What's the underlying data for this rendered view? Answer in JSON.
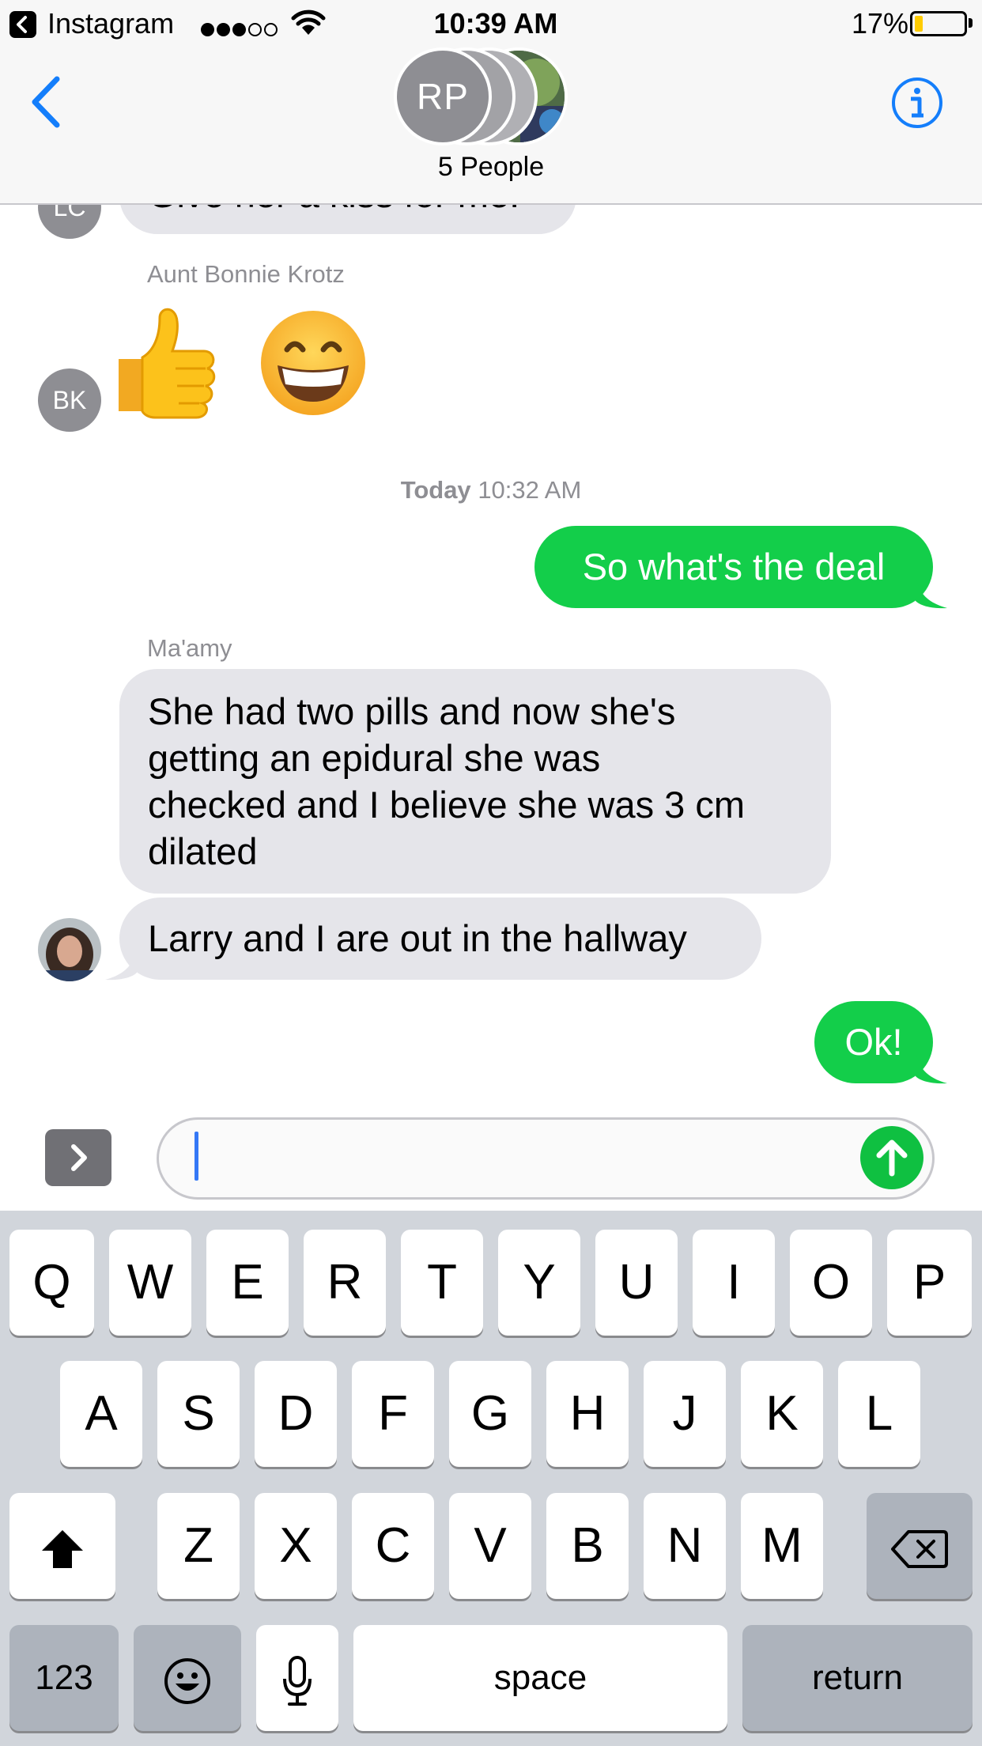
{
  "status_bar": {
    "back_app": "Instagram",
    "signal_bars_filled": 3,
    "signal_bars_total": 5,
    "time": "10:39 AM",
    "battery_percent": "17%",
    "battery_level": 0.17
  },
  "header": {
    "group_initials": "RP",
    "group_count": "5 People"
  },
  "conversation": {
    "partial_message": {
      "avatar_initials": "LC",
      "text": "Give her a kiss for me."
    },
    "emoji_message": {
      "sender": "Aunt Bonnie Krotz",
      "avatar_initials": "BK",
      "emojis": [
        "👍",
        "😁"
      ]
    },
    "timestamp": {
      "day": "Today",
      "time": "10:32 AM"
    },
    "sent_1": "So what's the deal",
    "maamy_sender": "Ma'amy",
    "maamy_1_lines": [
      "She had two pills and now she's",
      "getting an epidural she was",
      "checked and I believe she was 3 cm",
      "dilated"
    ],
    "maamy_2": "Larry and I are out in the hallway",
    "sent_2": "Ok!"
  },
  "input_bar": {
    "value": ""
  },
  "keyboard": {
    "row1": [
      "Q",
      "W",
      "E",
      "R",
      "T",
      "Y",
      "U",
      "I",
      "O",
      "P"
    ],
    "row2": [
      "A",
      "S",
      "D",
      "F",
      "G",
      "H",
      "J",
      "K",
      "L"
    ],
    "row3": [
      "Z",
      "X",
      "C",
      "V",
      "B",
      "N",
      "M"
    ],
    "numbers_key": "123",
    "space_key": "space",
    "return_key": "return"
  },
  "colors": {
    "ios_blue": "#147efb",
    "sent_bubble": "#13ce4a",
    "received_bubble": "#e5e5ea",
    "timestamp_gray": "#8e8e93",
    "send_button": "#0fc041",
    "battery_yellow": "#ffcc00"
  },
  "icons": [
    "back-app-icon",
    "wifi-icon",
    "battery-icon",
    "back-chevron-icon",
    "info-icon",
    "apps-chevron-icon",
    "send-arrow-icon",
    "shift-icon",
    "delete-icon",
    "emoji-icon",
    "microphone-icon"
  ]
}
